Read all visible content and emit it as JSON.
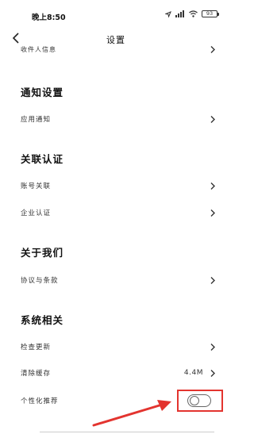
{
  "status_bar": {
    "time": "晚上8:50",
    "battery": "93"
  },
  "nav": {
    "title": "设置"
  },
  "partial_item": {
    "label": "收件人信息"
  },
  "sections": {
    "notifications": {
      "title": "通知设置",
      "items": [
        {
          "label": "应用通知"
        }
      ]
    },
    "linking": {
      "title": "关联认证",
      "items": [
        {
          "label": "账号关联"
        },
        {
          "label": "企业认证"
        }
      ]
    },
    "about": {
      "title": "关于我们",
      "items": [
        {
          "label": "协议与条款"
        }
      ]
    },
    "system": {
      "title": "系统相关",
      "items": [
        {
          "label": "检查更新"
        },
        {
          "label": "清除缓存",
          "value": "4.4M"
        },
        {
          "label": "个性化推荐",
          "toggle": false
        }
      ]
    }
  },
  "colors": {
    "highlight": "#e3342f",
    "background": "#ffffff",
    "text": "#222222"
  }
}
